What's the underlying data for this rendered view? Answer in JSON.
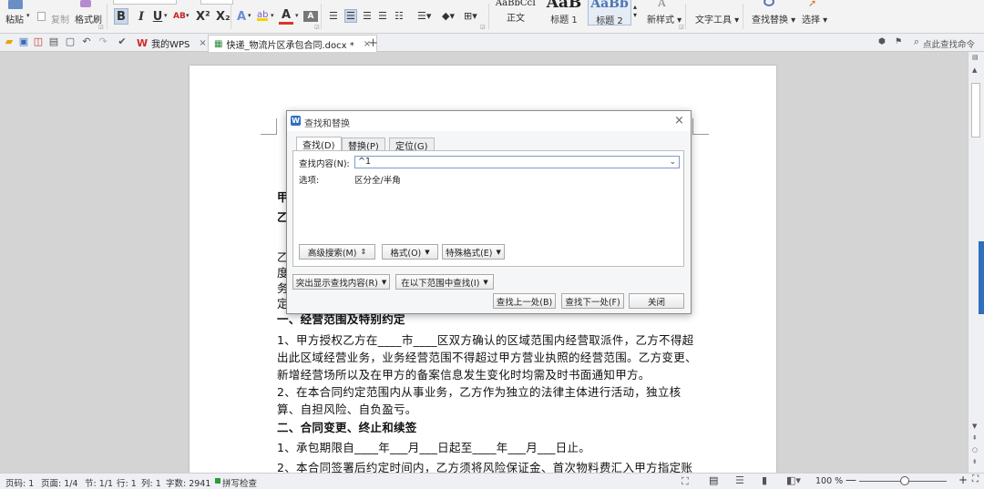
{
  "ribbon": {
    "paste": "粘贴",
    "copy": "复制",
    "format_painter": "格式刷",
    "bold": "B",
    "italic": "I",
    "underline": "U",
    "char_ab": "AB",
    "superscript": "X²",
    "subscript": "X₂",
    "font_color_a": "A",
    "styles": [
      {
        "preview": "AaBbCcI",
        "label": "正文"
      },
      {
        "preview": "AaB",
        "label": "标题 1"
      },
      {
        "preview": "AaBb",
        "label": "标题 2"
      }
    ],
    "new_style": "新样式",
    "text_tools": "文字工具",
    "find_replace": "查找替换",
    "select": "选择"
  },
  "tabs": {
    "wps_tab": "我的WPS",
    "doc_tab": "快递_物流片区承包合同.docx *",
    "add": "+",
    "search_command": "点此查找命令"
  },
  "document": {
    "partial_lines": [
      "甲",
      "乙",
      "乙",
      "度",
      "务",
      "定"
    ],
    "heading1": "一、经营范围及特别约定",
    "p1_line1": "1、甲方授权乙方在____市____区双方确认的区域范围内经营取派件，乙方不得超",
    "p1_line2": "出此区域经营业务，业务经营范围不得超过甲方营业执照的经营范围。乙方变更、",
    "p1_line3": "新增经营场所以及在甲方的备案信息发生变化时均需及时书面通知甲方。",
    "p2_line1": "2、在本合同约定范围内从事业务，乙方作为独立的法律主体进行活动，独立核",
    "p2_line2": "算、自担风险、自负盈亏。",
    "heading2": "二、合同变更、终止和续签",
    "p3_line1": "1、承包期限自____年___月___日起至____年___月___日止。",
    "p4_line1": "2、本合同签署后约定时间内，乙方须将风险保证金、首次物料费汇入甲方指定账"
  },
  "dialog": {
    "title": "查找和替换",
    "tab_find": "查找(D)",
    "tab_replace": "替换(P)",
    "tab_goto": "定位(G)",
    "find_label": "查找内容(N):",
    "find_value": "^1",
    "options_label": "选项:",
    "options_value": "区分全/半角",
    "btn_advanced": "高级搜索(M)",
    "btn_format": "格式(O)",
    "btn_special": "特殊格式(E)",
    "btn_highlight": "突出显示查找内容(R)",
    "btn_range": "在以下范围中查找(I)",
    "btn_prev": "查找上一处(B)",
    "btn_next": "查找下一处(F)",
    "btn_close": "关闭"
  },
  "status": {
    "page_num": "页码: 1",
    "pages": "页面: 1/4",
    "section": "节: 1/1",
    "row": "行: 1",
    "col": "列: 1",
    "words": "字数: 2941",
    "spell": "拼写检查",
    "zoom": "100 %"
  },
  "colors": {
    "accent": "#2f6fbd",
    "wps_red": "#d4272a",
    "scroll_blue": "#2f6fbd"
  }
}
